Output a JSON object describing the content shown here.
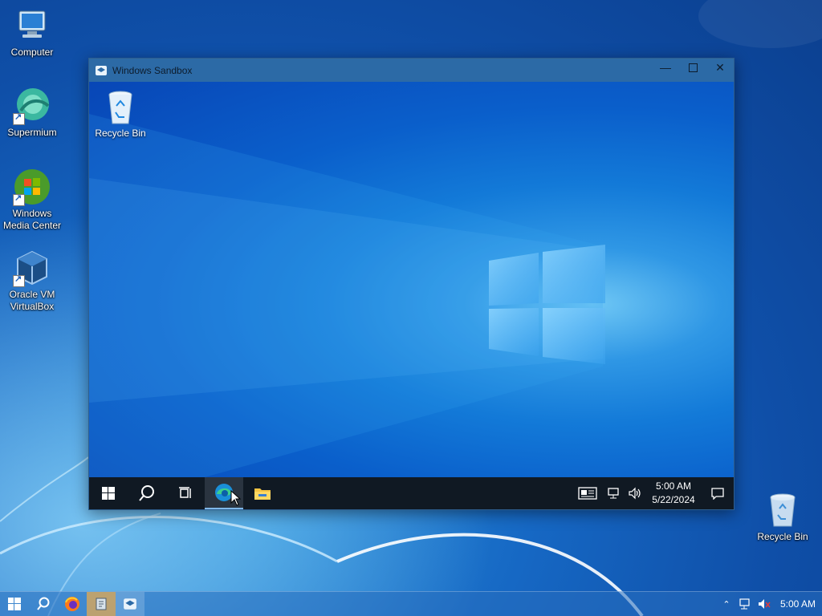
{
  "desktop": {
    "icons": [
      {
        "label": "Computer",
        "icon": "computer-icon"
      },
      {
        "label": "Supermium",
        "icon": "supermium-icon"
      },
      {
        "label": "Windows\nMedia Center",
        "icon": "windows-media-center-icon"
      },
      {
        "label": "Oracle VM\nVirtualBox",
        "icon": "virtualbox-icon"
      }
    ],
    "recycle_bin": {
      "label": "Recycle Bin",
      "icon": "recycle-bin-icon"
    }
  },
  "sandbox_window": {
    "title": "Windows Sandbox",
    "controls": [
      "minimize",
      "maximize",
      "close"
    ],
    "inner_desktop": {
      "recycle_bin_label": "Recycle Bin"
    },
    "taskbar": {
      "buttons": [
        "start-icon",
        "search-icon",
        "task-view-icon",
        "edge-icon",
        "file-explorer-icon"
      ],
      "active_button": "edge-icon",
      "tray": {
        "time": "5:00 AM",
        "date": "5/22/2024"
      }
    }
  },
  "host_taskbar": {
    "buttons": [
      "start-icon",
      "search-icon",
      "firefox-icon",
      "app-icon",
      "windows-sandbox-icon"
    ],
    "tray": {
      "time": "5:00 AM"
    }
  },
  "colors": {
    "host_bg": "#1668c4",
    "sandbox_titlebar": "#2c6aa6",
    "win10_taskbar": "#101923"
  }
}
